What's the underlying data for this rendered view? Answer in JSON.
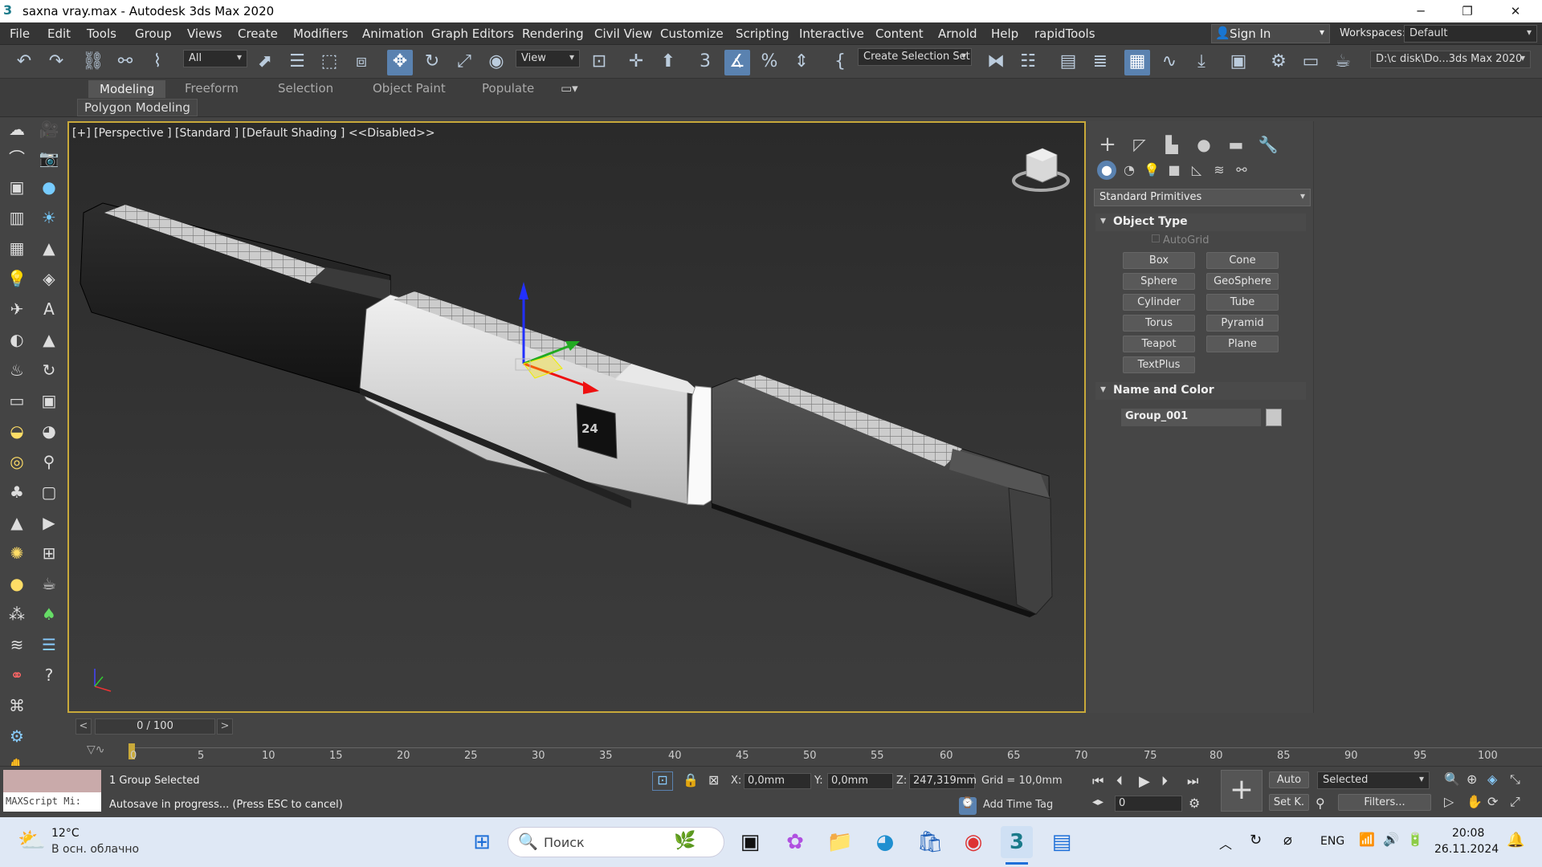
{
  "window": {
    "title": "saxna vray.max - Autodesk 3ds Max 2020",
    "minimize": "─",
    "restore": "❐",
    "close": "✕"
  },
  "menu": [
    "File",
    "Edit",
    "Tools",
    "Group",
    "Views",
    "Create",
    "Modifiers",
    "Animation",
    "Graph Editors",
    "Rendering",
    "Civil View",
    "Customize",
    "Scripting",
    "Interactive",
    "Content",
    "Arnold",
    "Help",
    "rapidTools"
  ],
  "signin": "Sign In",
  "workspaces": {
    "label": "Workspaces:",
    "value": "Default"
  },
  "toolbar": {
    "filter": "All",
    "view": "View",
    "selection_set": "Create Selection Set",
    "path": "D:\\c disk\\Do...3ds Max 2020"
  },
  "ribbon": {
    "tabs": [
      "Modeling",
      "Freeform",
      "Selection",
      "Object Paint",
      "Populate"
    ],
    "sub": "Polygon Modeling"
  },
  "viewport": {
    "label": "[+] [Perspective ] [Standard ] [Default Shading ]  <<Disabled>>",
    "tag": "24"
  },
  "panel": {
    "dropdown": "Standard Primitives",
    "object_type": "Object Type",
    "autogrid": "AutoGrid",
    "buttons": [
      "Box",
      "Cone",
      "Sphere",
      "GeoSphere",
      "Cylinder",
      "Tube",
      "Torus",
      "Pyramid",
      "Teapot",
      "Plane",
      "TextPlus"
    ],
    "name_color": "Name and Color",
    "name_value": "Group_001",
    "object_color": "#c8c8c8"
  },
  "timeslider": {
    "value": "0 / 100",
    "prev": "<",
    "next": ">"
  },
  "timeline": {
    "ticks": [
      "0",
      "5",
      "10",
      "15",
      "20",
      "25",
      "30",
      "35",
      "40",
      "45",
      "50",
      "55",
      "60",
      "65",
      "70",
      "75",
      "80",
      "85",
      "90",
      "95",
      "100"
    ]
  },
  "status": {
    "maxscript": "MAXScript Mi:",
    "selected": "1 Group Selected",
    "prompt": "Autosave in progress... (Press ESC to cancel)",
    "x_label": "X:",
    "x": "0,0mm",
    "y_label": "Y:",
    "y": "0,0mm",
    "z_label": "Z:",
    "z": "247,319mm",
    "grid": "Grid = 10,0mm",
    "add_time_tag": "Add Time Tag",
    "auto": "Auto",
    "setk": "Set K.",
    "selected_dd": "Selected",
    "filters": "Filters...",
    "frame": "0"
  },
  "taskbar": {
    "temp": "12°C",
    "weather": "В осн. облачно",
    "search": "Поиск",
    "lang": "ENG",
    "time": "20:08",
    "date": "26.11.2024"
  }
}
